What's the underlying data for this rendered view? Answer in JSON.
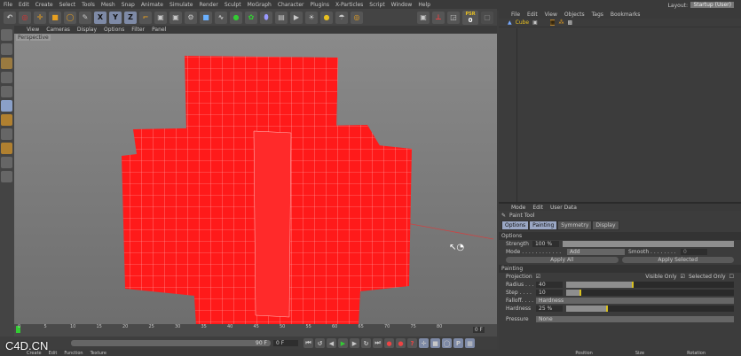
{
  "menu": [
    "File",
    "Edit",
    "Create",
    "Select",
    "Tools",
    "Mesh",
    "Snap",
    "Animate",
    "Simulate",
    "Render",
    "Sculpt",
    "MoGraph",
    "Character",
    "Plugins",
    "X-Particles",
    "Script",
    "Window",
    "Help"
  ],
  "layout": {
    "label": "Layout:",
    "value": "Startup (User)"
  },
  "toolbar": {
    "axes": [
      "X",
      "Y",
      "Z"
    ],
    "psr_label": "PSR",
    "psr_value": "0"
  },
  "viewport": {
    "menu": [
      "View",
      "Cameras",
      "Display",
      "Options",
      "Filter",
      "Panel"
    ],
    "camera_label": "Perspective",
    "accent": "#ff2020"
  },
  "timeline": {
    "ticks": [
      "0",
      "5",
      "10",
      "15",
      "20",
      "25",
      "30",
      "35",
      "40",
      "45",
      "50",
      "55",
      "60",
      "65",
      "70",
      "75",
      "80"
    ],
    "end_label": "0 F",
    "frame_field": "90 F",
    "start_field": "0 F"
  },
  "object_manager": {
    "menu": [
      "File",
      "Edit",
      "View",
      "Objects",
      "Tags",
      "Bookmarks"
    ],
    "object": "Cube"
  },
  "attributes": {
    "menu": [
      "Mode",
      "Edit",
      "User Data"
    ],
    "tool": "Paint Tool",
    "tabs": [
      "Options",
      "Painting",
      "Symmetry",
      "Display"
    ],
    "active_tabs": [
      "Options",
      "Painting"
    ],
    "options_header": "Options",
    "strength_label": "Strength",
    "strength_value": "100 %",
    "mode_label": "Mode . . . . . . . . . . . .",
    "mode_value": "Add",
    "smooth_label": "Smooth . . . . . . . . . . . .",
    "smooth_value": "0",
    "apply_all": "Apply All",
    "apply_selected": "Apply Selected",
    "painting_header": "Painting",
    "projection_label": "Projection",
    "visible_only": "Visible Only",
    "selected_only": "Selected Only",
    "radius_label": "Radius . . .",
    "radius_value": "40",
    "radius_pct": 40,
    "step_label": "Step . . . .",
    "step_value": "10",
    "step_pct": 9,
    "falloff_label": "Falloff. . . .",
    "falloff_value": "Hardness",
    "hardness_label": "Hardness",
    "hardness_value": "25 %",
    "hardness_pct": 25,
    "pressure_label": "Pressure",
    "pressure_value": "None"
  },
  "bottom": {
    "menu": [
      "Create",
      "Edit",
      "Function",
      "Texture"
    ],
    "coords": [
      "Position",
      "Size",
      "Rotation"
    ]
  },
  "watermark": "C4D.CN"
}
